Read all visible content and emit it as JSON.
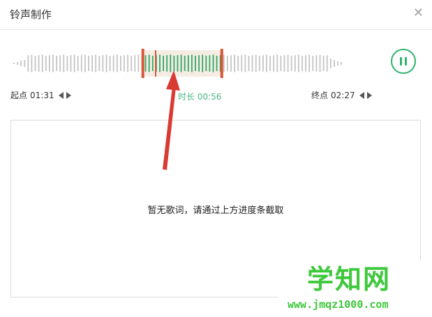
{
  "dialog": {
    "title": "铃声制作",
    "close_icon": "close-icon"
  },
  "waveform": {
    "bar_count": 93,
    "selection_start_bar": 37,
    "selection_end_bar": 58,
    "playhead_bar": 40,
    "colors": {
      "bar": "#c4c4c4",
      "selected_bar": "#2fa865",
      "selection_bg": "#f5ece4",
      "handle": "#d9573a"
    }
  },
  "controls": {
    "pause_icon": "pause-icon",
    "accent": "#2fb36b"
  },
  "start": {
    "label": "起点",
    "time": "01:31"
  },
  "duration": {
    "text": "时长 00:56"
  },
  "end": {
    "label": "终点",
    "time": "02:27"
  },
  "lyrics": {
    "empty_message": "暂无歌词，请通过上方进度条截取"
  },
  "annotation": {
    "color": "#d93a32"
  },
  "watermark": {
    "brand": "学知网",
    "url": "www.jmqz1000.com"
  }
}
